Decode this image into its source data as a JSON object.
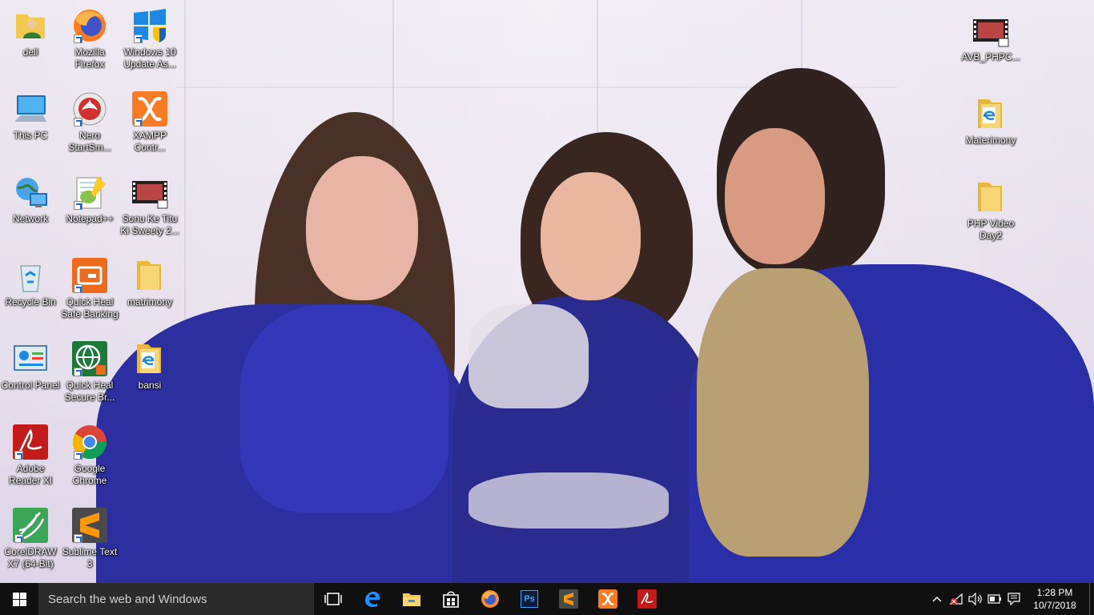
{
  "desktop": {
    "left_icons": [
      {
        "label": "dell",
        "icon": "user-folder-icon",
        "shortcut": false
      },
      {
        "label": "Mozilla Firefox",
        "icon": "firefox-icon",
        "shortcut": true
      },
      {
        "label": "Windows 10 Update As...",
        "icon": "windows-update-icon",
        "shortcut": true
      },
      {
        "label": "This PC",
        "icon": "computer-icon",
        "shortcut": false
      },
      {
        "label": "Nero StartSm...",
        "icon": "nero-icon",
        "shortcut": true
      },
      {
        "label": "XAMPP Contr...",
        "icon": "xampp-icon",
        "shortcut": true
      },
      {
        "label": "Network",
        "icon": "network-icon",
        "shortcut": false
      },
      {
        "label": "Notepad++",
        "icon": "notepad-plus-plus-icon",
        "shortcut": true
      },
      {
        "label": "Sonu Ke Titu Ki Sweety 2...",
        "icon": "video-file-icon",
        "shortcut": false
      },
      {
        "label": "Recycle Bin",
        "icon": "recycle-bin-icon",
        "shortcut": false
      },
      {
        "label": "Quick Heal Safe Banking",
        "icon": "safe-banking-icon",
        "shortcut": true
      },
      {
        "label": "matrimony",
        "icon": "folder-icon",
        "shortcut": false
      },
      {
        "label": "Control Panel",
        "icon": "control-panel-icon",
        "shortcut": false
      },
      {
        "label": "Quick Heal Secure Br...",
        "icon": "secure-browser-icon",
        "shortcut": true
      },
      {
        "label": "bansi",
        "icon": "web-folder-icon",
        "shortcut": false
      },
      {
        "label": "Adobe Reader XI",
        "icon": "adobe-reader-icon",
        "shortcut": true
      },
      {
        "label": "Google Chrome",
        "icon": "chrome-icon",
        "shortcut": true
      },
      {
        "label": "CorelDRAW X7 (64-Bit)",
        "icon": "coreldraw-icon",
        "shortcut": true
      },
      {
        "label": "Sublime Text 3",
        "icon": "sublime-text-icon",
        "shortcut": true
      }
    ],
    "right_icons": [
      {
        "label": "AVB_PHPC...",
        "icon": "video-file-icon"
      },
      {
        "label": "Materimony",
        "icon": "web-folder-icon"
      },
      {
        "label": "PHP Video Day2",
        "icon": "folder-icon"
      }
    ]
  },
  "taskbar": {
    "search_placeholder": "Search the web and Windows",
    "pinned_apps": [
      "task-view-icon",
      "edge-icon",
      "file-explorer-icon",
      "store-icon",
      "firefox-icon",
      "photoshop-icon",
      "sublime-text-icon",
      "xampp-icon",
      "adobe-reader-icon"
    ],
    "photoshop_label": "Ps",
    "tray": [
      "chevron-up-icon",
      "network-disconnected-icon",
      "volume-icon",
      "battery-icon",
      "action-center-icon"
    ],
    "time": "1:28 PM",
    "date": "10/7/2018"
  },
  "colors": {
    "taskbar": "#101010",
    "search_box": "#2b2b2b",
    "accent": "#1a66c9"
  }
}
